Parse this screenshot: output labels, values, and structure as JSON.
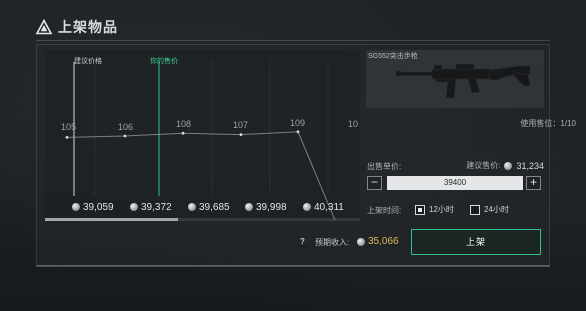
{
  "title": "上架物品",
  "chart_data": {
    "type": "line",
    "labels": {
      "suggested": "建议价格",
      "yours": "你的售价"
    },
    "prices": [
      "39,059",
      "39,372",
      "39,685",
      "39,998",
      "40,311"
    ],
    "counts": [
      105,
      106,
      108,
      107,
      109,
      10
    ],
    "count_labels": [
      "105",
      "106",
      "108",
      "107",
      "109",
      "10"
    ]
  },
  "item": {
    "name": "SG552突击步枪",
    "slots": "使用售位：1/10"
  },
  "sell": {
    "unit_label": "出售单价:",
    "suggested_label": "建议售价:",
    "suggested_value": "31,234",
    "minus": "−",
    "plus": "+",
    "input_value": "39400"
  },
  "duration": {
    "label": "上架时间:",
    "options": [
      "12小时",
      "24小时"
    ],
    "selected_index": 0
  },
  "summary": {
    "help": "?",
    "expected_label": "预期收入:",
    "expected_value": "35,066"
  },
  "action": {
    "list_label": "上架"
  },
  "colors": {
    "accent_green": "#2fbf88",
    "coin_gold_text": "#e1b75a"
  }
}
